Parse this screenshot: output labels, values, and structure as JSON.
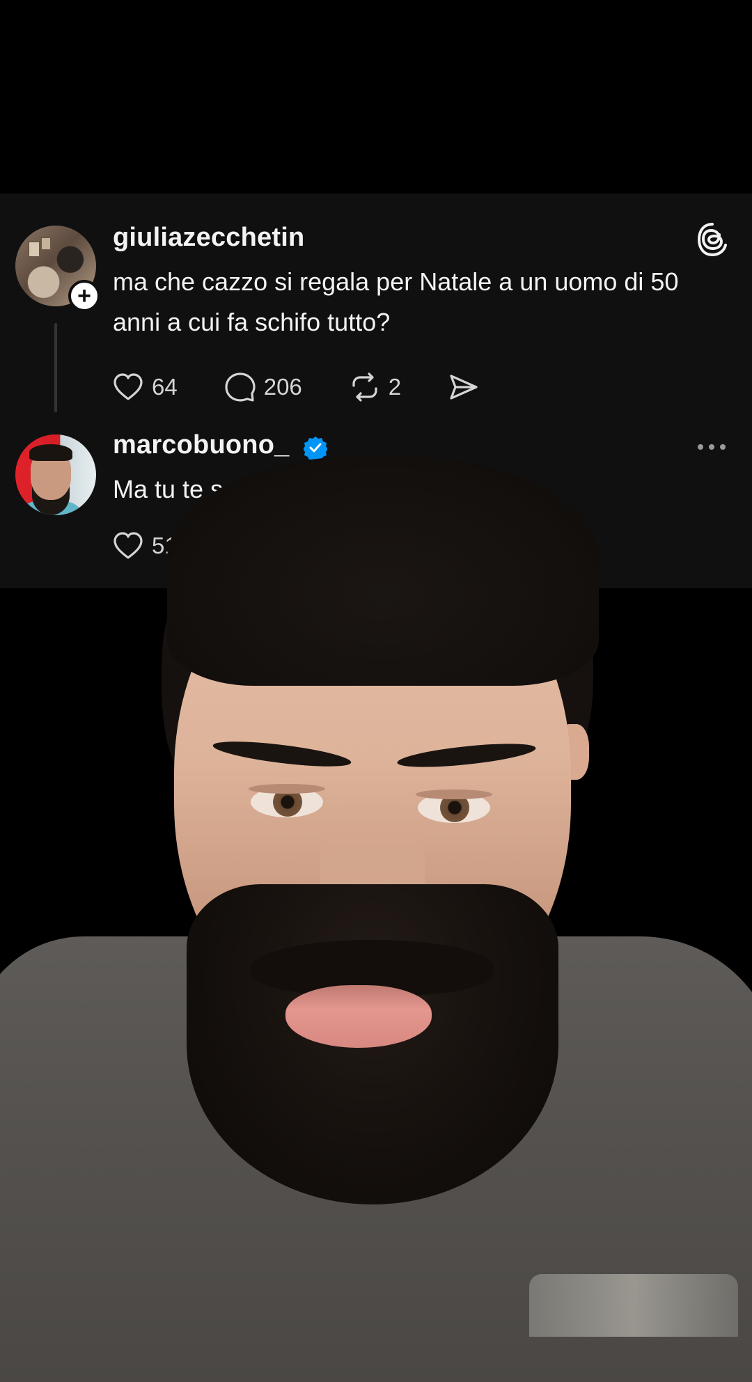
{
  "post": {
    "username": "giuliazecchetin",
    "text": "ma che cazzo si regala per Natale a un uomo di 50 anni a cui fa schifo tutto?",
    "follow_icon": "plus-icon",
    "brand_icon": "threads-logo-icon",
    "actions": {
      "likes": "64",
      "comments": "206",
      "reposts": "2",
      "share_icon": "send-icon"
    }
  },
  "reply": {
    "username": "marcobuono_",
    "verified": true,
    "text": "Ma tu te sei",
    "menu_icon": "more-icon",
    "actions": {
      "likes": "51"
    }
  },
  "colors": {
    "card_bg": "#101010",
    "verified_blue": "#0095f6",
    "text": "#f3f3f3"
  }
}
